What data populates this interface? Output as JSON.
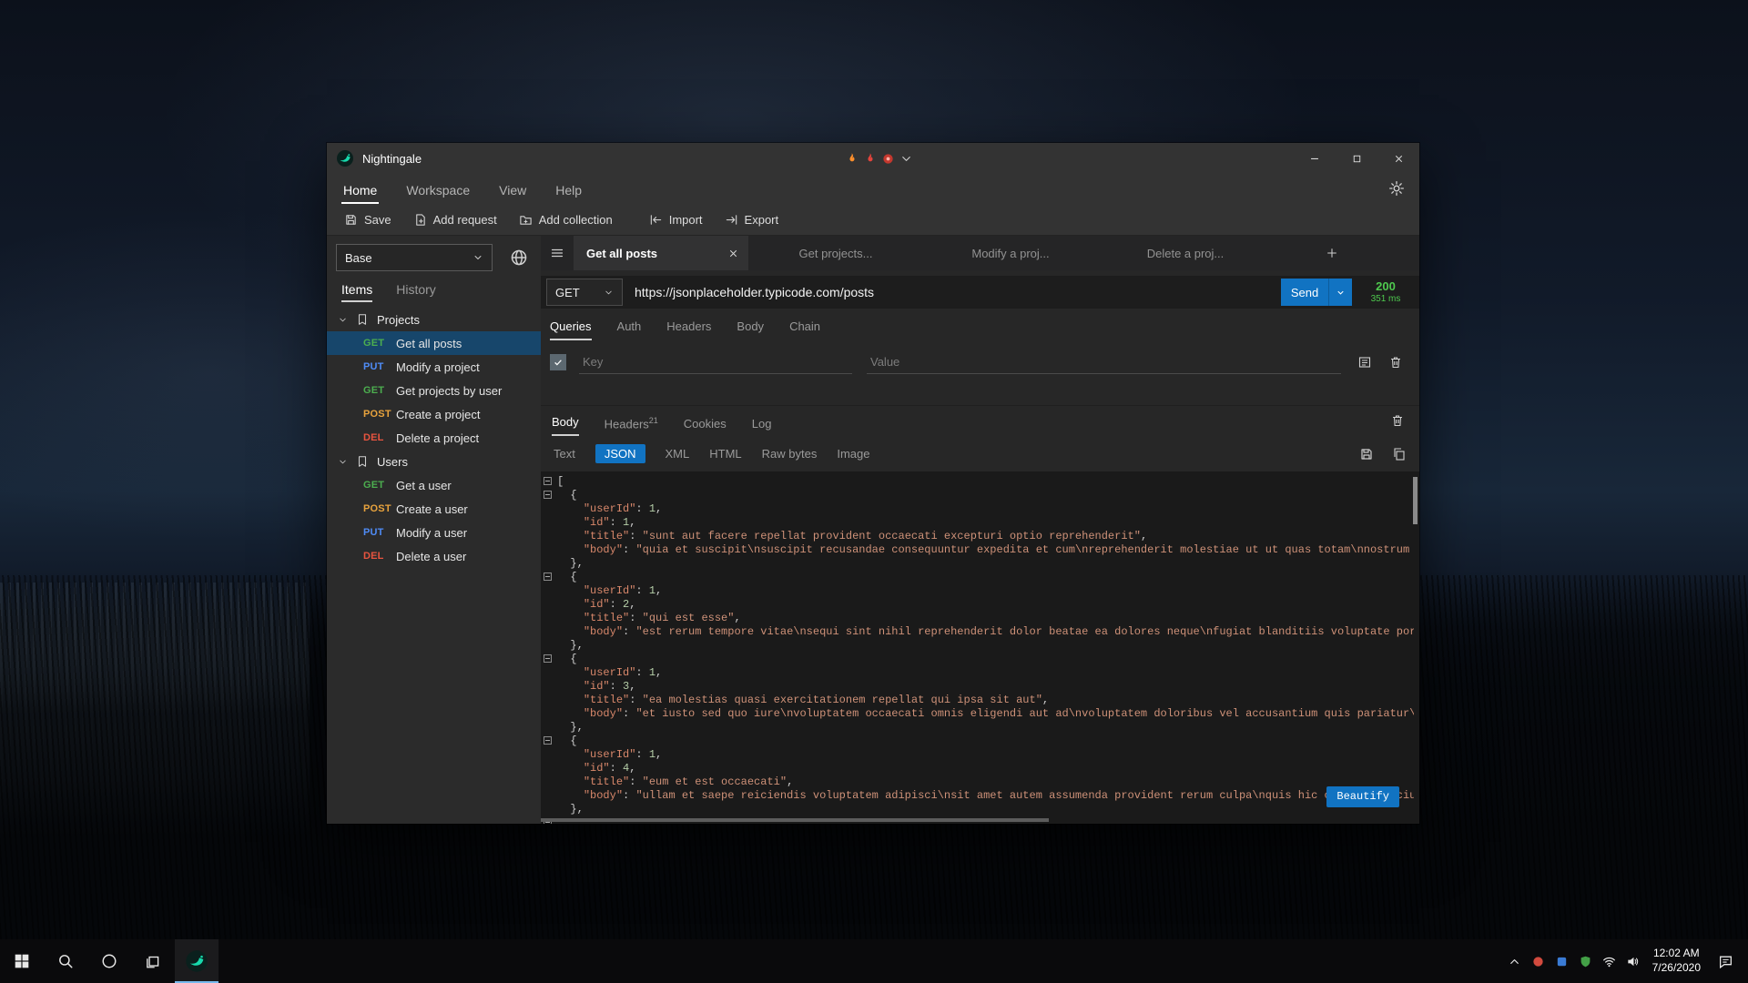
{
  "window": {
    "title": "Nightingale",
    "active_menu_index": 0,
    "menu": [
      "Home",
      "Workspace",
      "View",
      "Help"
    ],
    "toolbar": [
      {
        "label": "Save",
        "icon": "save"
      },
      {
        "label": "Add request",
        "icon": "add-request"
      },
      {
        "label": "Add collection",
        "icon": "add-collection"
      },
      {
        "label": "Import",
        "icon": "import"
      },
      {
        "label": "Export",
        "icon": "export"
      }
    ],
    "flair_icons": [
      "flame",
      "hot-flame",
      "record"
    ],
    "controls": [
      {
        "name": "minimize",
        "icon": "minimize"
      },
      {
        "name": "maximize",
        "icon": "maximize"
      },
      {
        "name": "close",
        "icon": "close"
      }
    ]
  },
  "method_colors": {
    "GET": "#4cae4f",
    "PUT": "#4f8cf7",
    "POST": "#e8a33d",
    "DEL": "#e8543f"
  },
  "sidebar": {
    "workspace_selector": "Base",
    "tabs": [
      {
        "label": "Items",
        "active": true
      },
      {
        "label": "History",
        "active": false
      }
    ],
    "tree": [
      {
        "type": "group",
        "label": "Projects"
      },
      {
        "type": "request",
        "method": "GET",
        "label": "Get all posts",
        "selected": true
      },
      {
        "type": "request",
        "method": "PUT",
        "label": "Modify a project"
      },
      {
        "type": "request",
        "method": "GET",
        "label": "Get projects by user"
      },
      {
        "type": "request",
        "method": "POST",
        "label": "Create a project"
      },
      {
        "type": "request",
        "method": "DEL",
        "label": "Delete a project"
      },
      {
        "type": "group",
        "label": "Users"
      },
      {
        "type": "request",
        "method": "GET",
        "label": "Get a user"
      },
      {
        "type": "request",
        "method": "POST",
        "label": "Create a user"
      },
      {
        "type": "request",
        "method": "PUT",
        "label": "Modify a user"
      },
      {
        "type": "request",
        "method": "DEL",
        "label": "Delete a user"
      }
    ]
  },
  "tabs": [
    {
      "label": "Get all posts",
      "active": true
    },
    {
      "label": "Get projects...",
      "active": false
    },
    {
      "label": "Modify a proj...",
      "active": false
    },
    {
      "label": "Delete a proj...",
      "active": false
    }
  ],
  "request": {
    "method": "GET",
    "url": "https://jsonplaceholder.typicode.com/posts",
    "send_label": "Send",
    "status_code": "200",
    "status_time": "351 ms",
    "tabs": [
      "Queries",
      "Auth",
      "Headers",
      "Body",
      "Chain"
    ],
    "active_tab": "Queries",
    "query_key_placeholder": "Key",
    "query_value_placeholder": "Value"
  },
  "response": {
    "tabs": [
      {
        "label": "Body",
        "active": true
      },
      {
        "label": "Headers",
        "badge": "21"
      },
      {
        "label": "Cookies"
      },
      {
        "label": "Log"
      }
    ],
    "format_tabs": [
      "Text",
      "JSON",
      "XML",
      "HTML",
      "Raw bytes",
      "Image"
    ],
    "active_format": "JSON",
    "beautify_label": "Beautify",
    "body_lines": [
      {
        "i": 0,
        "f": true,
        "t": [
          [
            "p",
            "["
          ]
        ]
      },
      {
        "i": 1,
        "f": true,
        "t": [
          [
            "p",
            "{"
          ]
        ]
      },
      {
        "i": 2,
        "t": [
          [
            "k",
            "\"userId\""
          ],
          [
            "p",
            ": "
          ],
          [
            "n",
            "1"
          ],
          [
            "p",
            ","
          ]
        ]
      },
      {
        "i": 2,
        "t": [
          [
            "k",
            "\"id\""
          ],
          [
            "p",
            ": "
          ],
          [
            "n",
            "1"
          ],
          [
            "p",
            ","
          ]
        ]
      },
      {
        "i": 2,
        "t": [
          [
            "k",
            "\"title\""
          ],
          [
            "p",
            ": "
          ],
          [
            "s",
            "\"sunt aut facere repellat provident occaecati excepturi optio reprehenderit\""
          ],
          [
            "p",
            ","
          ]
        ]
      },
      {
        "i": 2,
        "t": [
          [
            "k",
            "\"body\""
          ],
          [
            "p",
            ": "
          ],
          [
            "s",
            "\"quia et suscipit\\nsuscipit recusandae consequuntur expedita et cum\\nreprehenderit molestiae ut ut quas totam\\nnostrum rerum est autem sunt rem eveniet architecto\""
          ]
        ]
      },
      {
        "i": 1,
        "t": [
          [
            "p",
            "},"
          ]
        ]
      },
      {
        "i": 1,
        "f": true,
        "t": [
          [
            "p",
            "{"
          ]
        ]
      },
      {
        "i": 2,
        "t": [
          [
            "k",
            "\"userId\""
          ],
          [
            "p",
            ": "
          ],
          [
            "n",
            "1"
          ],
          [
            "p",
            ","
          ]
        ]
      },
      {
        "i": 2,
        "t": [
          [
            "k",
            "\"id\""
          ],
          [
            "p",
            ": "
          ],
          [
            "n",
            "2"
          ],
          [
            "p",
            ","
          ]
        ]
      },
      {
        "i": 2,
        "t": [
          [
            "k",
            "\"title\""
          ],
          [
            "p",
            ": "
          ],
          [
            "s",
            "\"qui est esse\""
          ],
          [
            "p",
            ","
          ]
        ]
      },
      {
        "i": 2,
        "t": [
          [
            "k",
            "\"body\""
          ],
          [
            "p",
            ": "
          ],
          [
            "s",
            "\"est rerum tempore vitae\\nsequi sint nihil reprehenderit dolor beatae ea dolores neque\\nfugiat blanditiis voluptate porro vel nihil molestiae ut reiciendis\\nqui aperiam non debitis possimus qui neque nisi nulla\""
          ]
        ]
      },
      {
        "i": 1,
        "t": [
          [
            "p",
            "},"
          ]
        ]
      },
      {
        "i": 1,
        "f": true,
        "t": [
          [
            "p",
            "{"
          ]
        ]
      },
      {
        "i": 2,
        "t": [
          [
            "k",
            "\"userId\""
          ],
          [
            "p",
            ": "
          ],
          [
            "n",
            "1"
          ],
          [
            "p",
            ","
          ]
        ]
      },
      {
        "i": 2,
        "t": [
          [
            "k",
            "\"id\""
          ],
          [
            "p",
            ": "
          ],
          [
            "n",
            "3"
          ],
          [
            "p",
            ","
          ]
        ]
      },
      {
        "i": 2,
        "t": [
          [
            "k",
            "\"title\""
          ],
          [
            "p",
            ": "
          ],
          [
            "s",
            "\"ea molestias quasi exercitationem repellat qui ipsa sit aut\""
          ],
          [
            "p",
            ","
          ]
        ]
      },
      {
        "i": 2,
        "t": [
          [
            "k",
            "\"body\""
          ],
          [
            "p",
            ": "
          ],
          [
            "s",
            "\"et iusto sed quo iure\\nvoluptatem occaecati omnis eligendi aut ad\\nvoluptatem doloribus vel accusantium quis pariatur\\nmolestiae porro eius odio et labore et velit aut\""
          ]
        ]
      },
      {
        "i": 1,
        "t": [
          [
            "p",
            "},"
          ]
        ]
      },
      {
        "i": 1,
        "f": true,
        "t": [
          [
            "p",
            "{"
          ]
        ]
      },
      {
        "i": 2,
        "t": [
          [
            "k",
            "\"userId\""
          ],
          [
            "p",
            ": "
          ],
          [
            "n",
            "1"
          ],
          [
            "p",
            ","
          ]
        ]
      },
      {
        "i": 2,
        "t": [
          [
            "k",
            "\"id\""
          ],
          [
            "p",
            ": "
          ],
          [
            "n",
            "4"
          ],
          [
            "p",
            ","
          ]
        ]
      },
      {
        "i": 2,
        "t": [
          [
            "k",
            "\"title\""
          ],
          [
            "p",
            ": "
          ],
          [
            "s",
            "\"eum et est occaecati\""
          ],
          [
            "p",
            ","
          ]
        ]
      },
      {
        "i": 2,
        "t": [
          [
            "k",
            "\"body\""
          ],
          [
            "p",
            ": "
          ],
          [
            "s",
            "\"ullam et saepe reiciendis voluptatem adipisci\\nsit amet autem assumenda provident rerum culpa\\nquis hic commodi nesciunt rem tenetur doloremque ipsam iure\\nquis sunt voluptatem rerum illo velit\""
          ]
        ]
      },
      {
        "i": 1,
        "t": [
          [
            "p",
            "},"
          ]
        ]
      },
      {
        "i": 1,
        "f": true,
        "t": [
          [
            "p",
            "{"
          ]
        ]
      }
    ]
  },
  "taskbar": {
    "buttons": [
      "start",
      "search",
      "cortana",
      "task-view",
      "nightingale"
    ],
    "active_app_index": 4,
    "tray_icons": [
      "chevron-up",
      "tray-red",
      "tray-blue",
      "shield",
      "network",
      "volume"
    ],
    "clock": {
      "time": "12:02 AM",
      "date": "7/26/2020"
    }
  }
}
